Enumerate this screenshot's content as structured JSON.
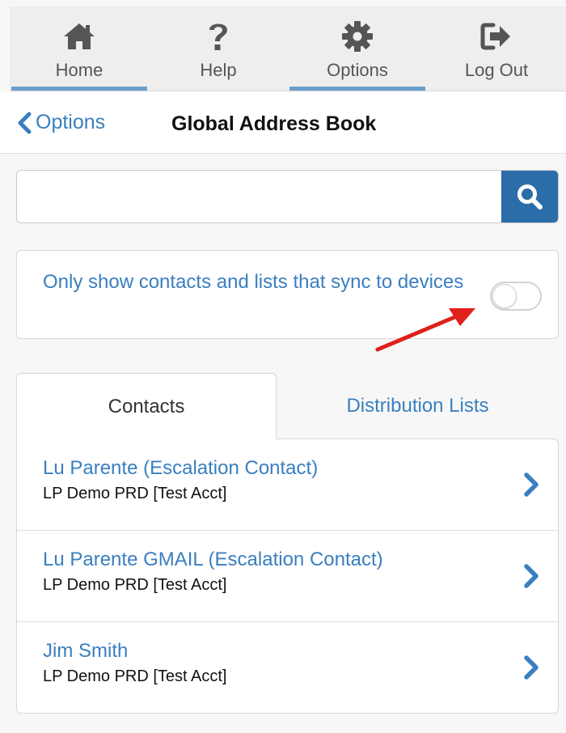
{
  "nav": {
    "items": [
      {
        "label": "Home",
        "icon": "home-icon",
        "active": true
      },
      {
        "label": "Help",
        "icon": "help-icon",
        "active": false
      },
      {
        "label": "Options",
        "icon": "gear-icon",
        "active": true
      },
      {
        "label": "Log Out",
        "icon": "logout-icon",
        "active": false
      }
    ]
  },
  "header": {
    "back_label": "Options",
    "title": "Global Address Book"
  },
  "search": {
    "value": "",
    "icon": "search-icon"
  },
  "sync_filter": {
    "label": "Only show contacts and lists that sync to devices",
    "enabled": false
  },
  "tabs": [
    {
      "label": "Contacts",
      "selected": true
    },
    {
      "label": "Distribution Lists",
      "selected": false
    }
  ],
  "contacts": [
    {
      "name": "Lu Parente (Escalation Contact)",
      "account": "LP Demo PRD [Test Acct]"
    },
    {
      "name": "Lu Parente GMAIL (Escalation Contact)",
      "account": "LP Demo PRD [Test Acct]"
    },
    {
      "name": "Jim Smith",
      "account": "LP Demo PRD [Test Acct]"
    }
  ],
  "colors": {
    "accent": "#3a7fbf",
    "search_button": "#2b6da8",
    "nav_active": "#6b9fcc",
    "annotation_arrow": "#e0201c"
  }
}
